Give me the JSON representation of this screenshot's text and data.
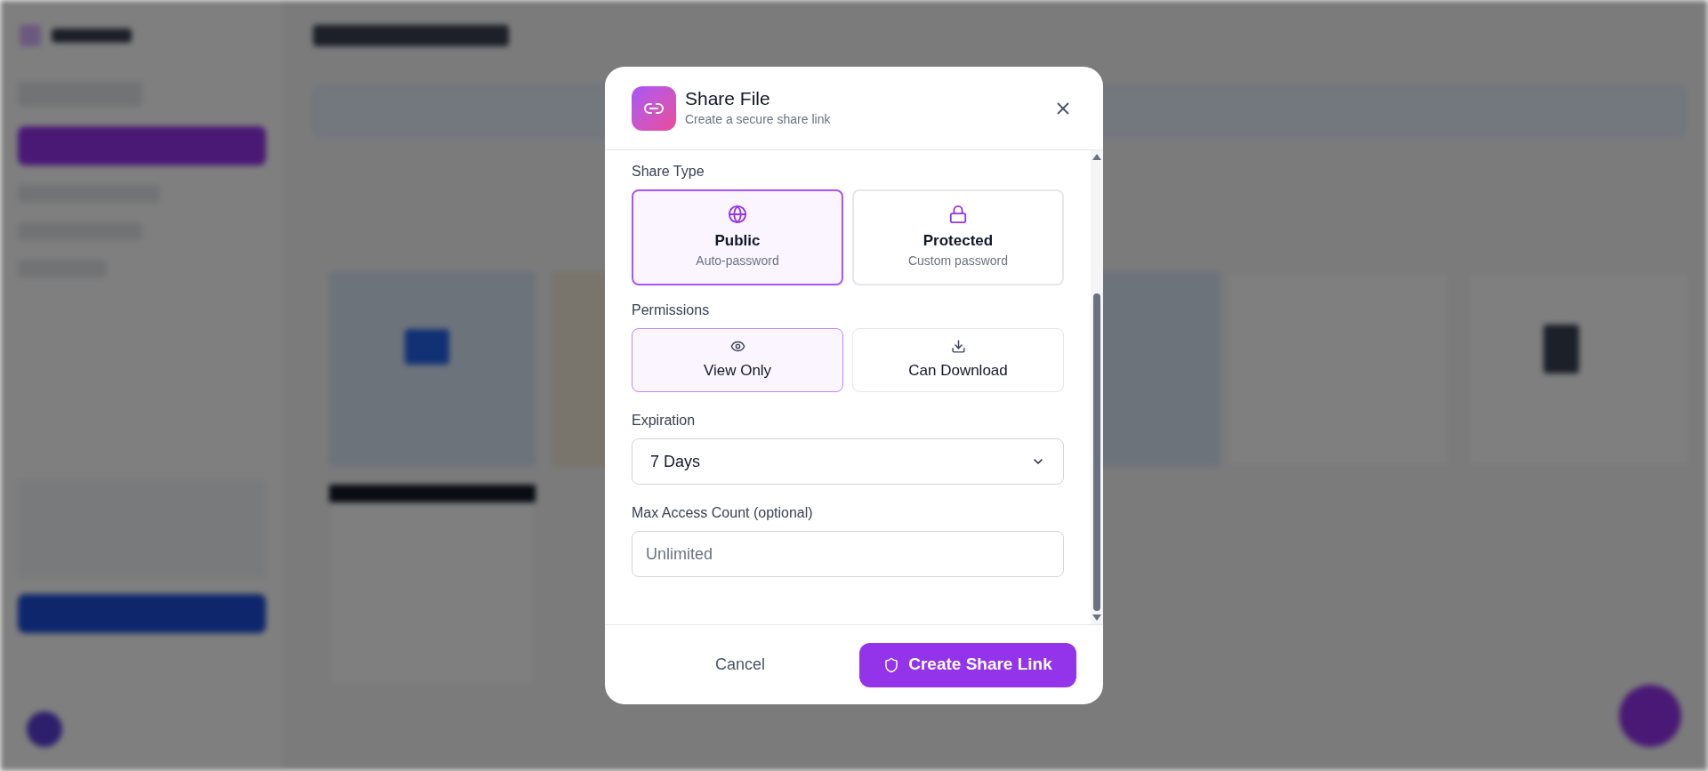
{
  "dialog": {
    "title": "Share File",
    "subtitle": "Create a secure share link",
    "share_type": {
      "label": "Share Type",
      "options": [
        {
          "kind": "globe",
          "title": "Public",
          "subtitle": "Auto-password",
          "selected": true
        },
        {
          "kind": "lock",
          "title": "Protected",
          "subtitle": "Custom password",
          "selected": false
        }
      ]
    },
    "permissions": {
      "label": "Permissions",
      "options": [
        {
          "kind": "eye",
          "title": "View Only",
          "selected": true
        },
        {
          "kind": "download",
          "title": "Can Download",
          "selected": false
        }
      ]
    },
    "expiration": {
      "label": "Expiration",
      "value": "7 Days"
    },
    "max_access": {
      "label": "Max Access Count (optional)",
      "placeholder": "Unlimited"
    },
    "buttons": {
      "cancel": "Cancel",
      "submit": "Create Share Link"
    }
  }
}
